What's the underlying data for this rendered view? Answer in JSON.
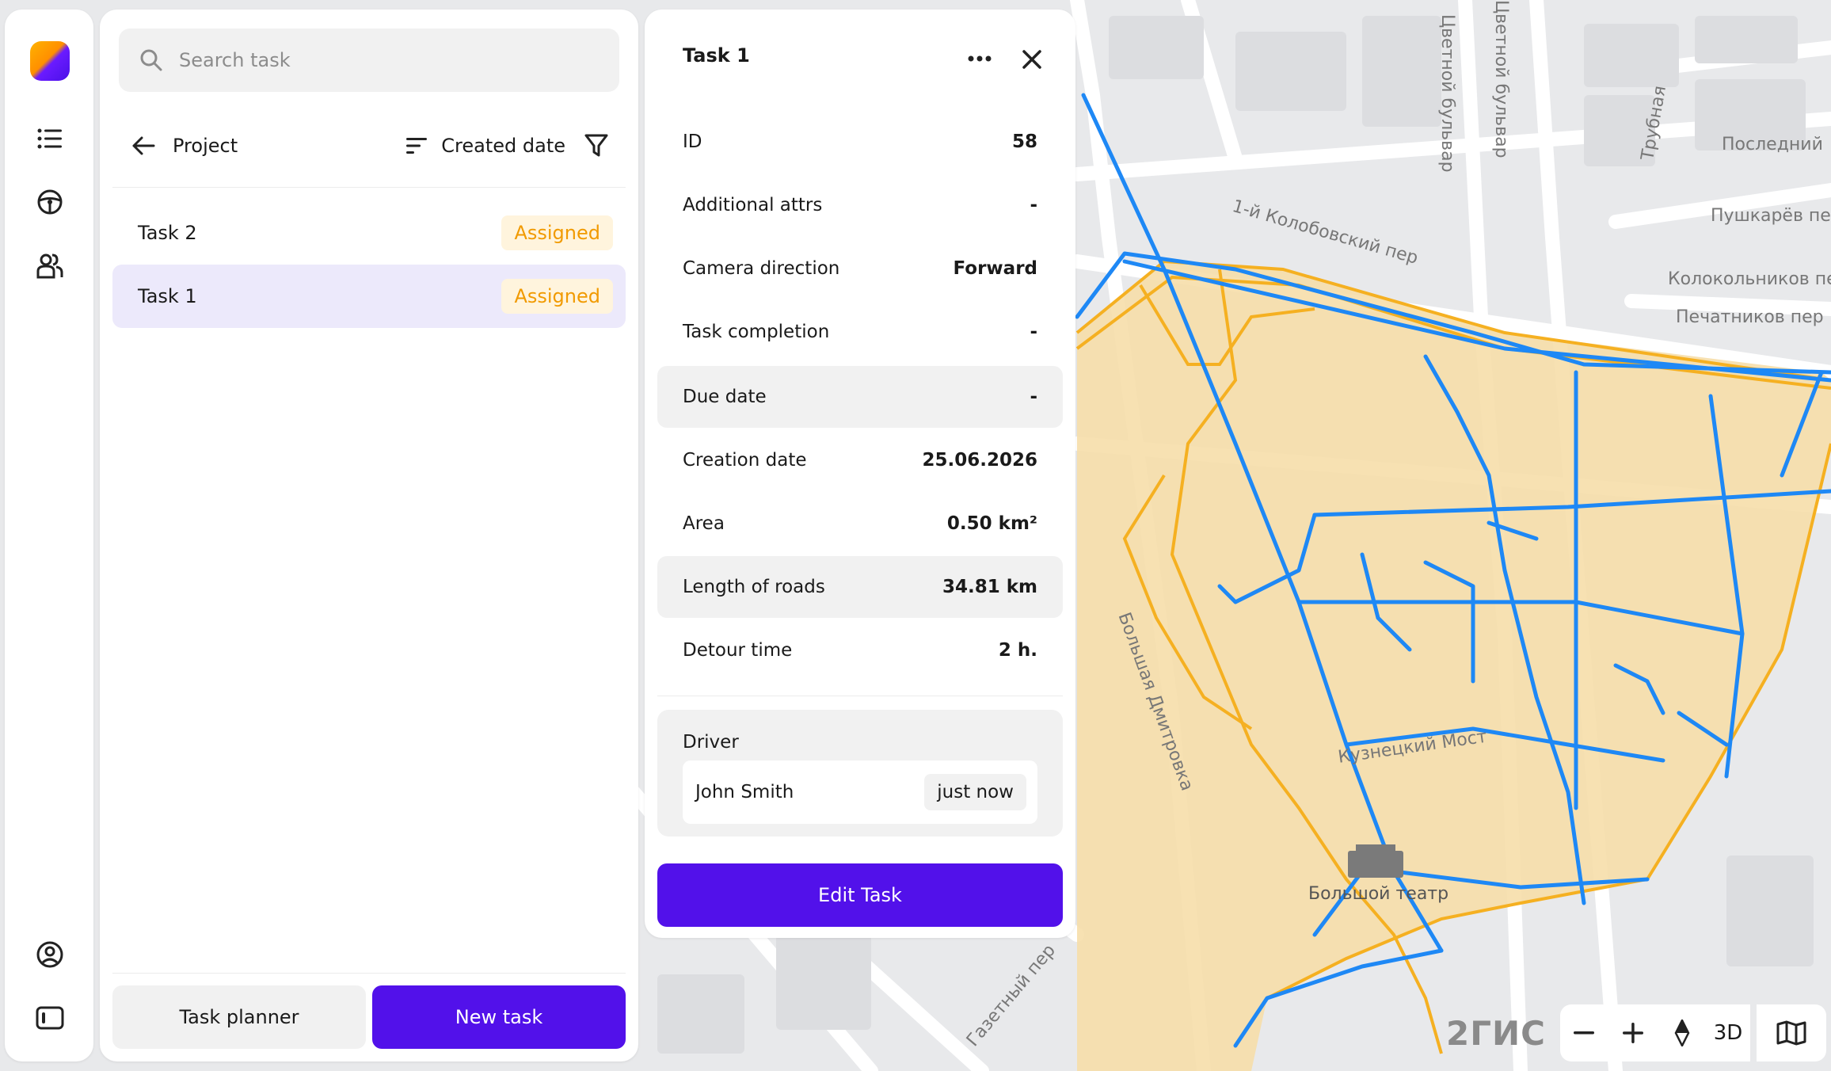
{
  "search": {
    "placeholder": "Search task"
  },
  "toolbar": {
    "back_label": "Project",
    "sort_label": "Created date"
  },
  "tasks": [
    {
      "name": "Task 2",
      "status": "Assigned"
    },
    {
      "name": "Task 1",
      "status": "Assigned"
    }
  ],
  "footer": {
    "planner_label": "Task planner",
    "new_label": "New task"
  },
  "detail": {
    "title": "Task 1",
    "rows": [
      {
        "label": "ID",
        "value": "58"
      },
      {
        "label": "Additional attrs",
        "value": "-"
      },
      {
        "label": "Camera direction",
        "value": "Forward"
      },
      {
        "label": "Task completion",
        "value": "-"
      },
      {
        "label": "Due date",
        "value": "-"
      },
      {
        "label": "Creation date",
        "value": "25.06.2026"
      },
      {
        "label": "Area",
        "value": "0.50 km²"
      },
      {
        "label": "Length of roads",
        "value": "34.81 km"
      },
      {
        "label": "Detour time",
        "value": "2 h."
      }
    ],
    "driver_label": "Driver",
    "driver_name": "John Smith",
    "driver_time": "just now",
    "edit_label": "Edit Task"
  },
  "map": {
    "brand": "2ГИС",
    "mode_3d": "3D",
    "streets": [
      "Цветной бульвар",
      "Цветной бульвар",
      "Трубная",
      "Последний",
      "Пушкарёв пер",
      "1-й Колобовский пер",
      "Колокольников пе",
      "Печатников пер",
      "Большая Дмитровка",
      "Кузнецкий Мост",
      "Газетный пер",
      "Большой театр"
    ]
  },
  "colors": {
    "accent": "#5211ea",
    "badge_text": "#f19a00",
    "badge_bg": "#fff4dd",
    "route_blue": "#1e88f5",
    "route_orange": "#f5b021",
    "area_fill": "#f6deaa"
  }
}
